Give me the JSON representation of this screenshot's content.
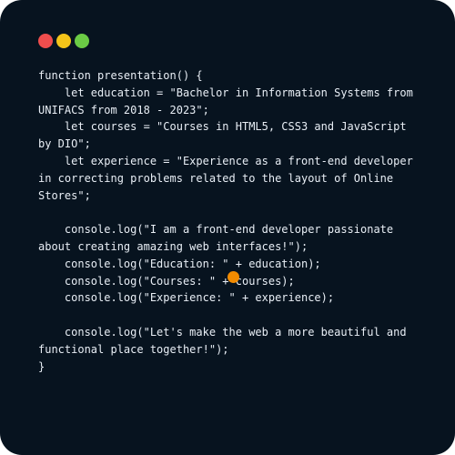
{
  "window": {
    "background": "#07131f",
    "controls": [
      {
        "name": "close",
        "color": "#ef4d4d"
      },
      {
        "name": "minimize",
        "color": "#f4c419"
      },
      {
        "name": "maximize",
        "color": "#6bcb45"
      }
    ]
  },
  "code": {
    "lines": [
      "function presentation() {",
      "    let education = \"Bachelor in Information Systems from",
      "UNIFACS from 2018 - 2023\";",
      "    let courses = \"Courses in HTML5, CSS3 and JavaScript",
      "by DIO\";",
      "    let experience = \"Experience as a front-end developer",
      "in correcting problems related to the layout of Online",
      "Stores\";",
      "",
      "    console.log(\"I am a front-end developer passionate",
      "about creating amazing web interfaces!\");",
      "    console.log(\"Education: \" + education);",
      "    console.log(\"Courses: \" + courses);",
      "    console.log(\"Experience: \" + experience);",
      "",
      "    console.log(\"Let's make the web a more beautiful and",
      "functional place together!\");",
      "}"
    ]
  },
  "cursor": {
    "color": "#f28b00"
  }
}
